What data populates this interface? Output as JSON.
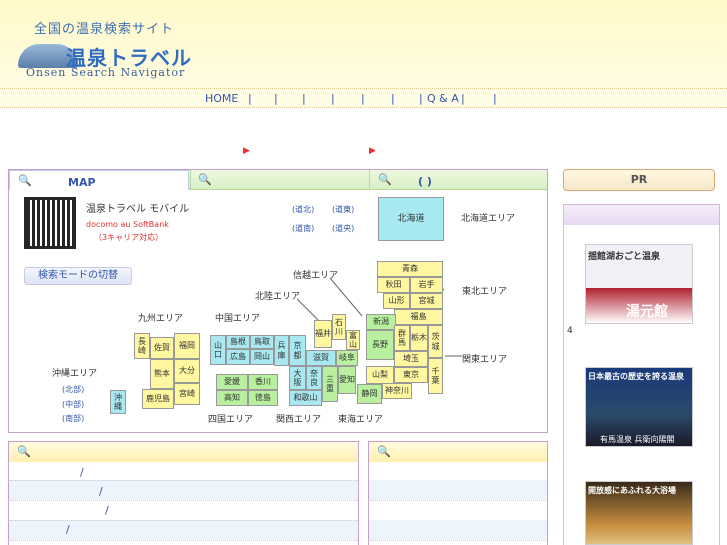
{
  "header": {
    "tagline": "全国の温泉検索サイト",
    "logo_text": "温泉トラベル",
    "logo_sub": "Onsen Search Navigator"
  },
  "nav": {
    "home": "HOME",
    "sep": "|",
    "qa": "Q & A"
  },
  "tabs": {
    "map": "MAP",
    "third": "(   )"
  },
  "mobile": {
    "title": "温泉トラベル モバイル",
    "carriers": "docomo au SoftBank",
    "note": "（3キャリア対応）"
  },
  "hokkaido_links": [
    "(道北)",
    "(道東)",
    "(道南)",
    "(道央)"
  ],
  "search_mode_button": "検索モードの切替",
  "areas": {
    "hokkaido": "北海道エリア",
    "tohoku": "東北エリア",
    "kanto": "関東エリア",
    "shinetsu": "信越エリア",
    "hokuriku": "北陸エリア",
    "chugoku": "中国エリア",
    "kyushu": "九州エリア",
    "okinawa": "沖縄エリア",
    "shikoku": "四国エリア",
    "kansai": "関西エリア",
    "tokai": "東海エリア"
  },
  "okinawa_links": [
    "(北部)",
    "(中部)",
    "(南部)"
  ],
  "prefectures": {
    "hokkaido": "北海道",
    "aomori": "青森",
    "akita": "秋田",
    "iwate": "岩手",
    "yamagata": "山形",
    "miyagi": "宮城",
    "fukushima": "福島",
    "niigata": "新潟",
    "gunma": "群馬",
    "tochigi": "栃木",
    "ibaraki": "茨城",
    "nagano": "長野",
    "saitama": "埼玉",
    "yamanashi": "山梨",
    "tokyo": "東京",
    "chiba": "千葉",
    "kanagawa": "神奈川",
    "shizuoka": "静岡",
    "toyama": "富山",
    "ishikawa": "石川",
    "fukui": "福井",
    "gifu": "岐阜",
    "aichi": "愛知",
    "mie": "三重",
    "shiga": "滋賀",
    "kyoto": "京都",
    "osaka": "大阪",
    "nara": "奈良",
    "wakayama": "和歌山",
    "hyogo": "兵庫",
    "tottori": "鳥取",
    "shimane": "島根",
    "okayama": "岡山",
    "hiroshima": "広島",
    "yamaguchi": "山口",
    "ehime": "愛媛",
    "kagawa": "香川",
    "kochi": "高知",
    "tokushima": "徳島",
    "fukuoka": "福岡",
    "saga": "佐賀",
    "nagasaki": "長崎",
    "kumamoto": "熊本",
    "oita": "大分",
    "miyazaki": "宮崎",
    "kagoshima": "鹿児島",
    "okinawa": "沖縄"
  },
  "sidebar": {
    "pr": "PR",
    "side_num": "4",
    "ad1_title": "揺館湖おごと温泉",
    "ad1_name": "湯元館",
    "ad2_title": "日本最古の歴史を誇る温泉",
    "ad2_name": "有馬温泉 兵衛向陽閣",
    "ad3_title": "開放感にあふれる大浴場"
  },
  "bottom": {
    "slash": "/"
  },
  "colors": {
    "accent": "#3355aa",
    "header_bg": "#fff9c8",
    "tab_green": "#d6efc4",
    "panel_border": "#c8a0d0"
  }
}
